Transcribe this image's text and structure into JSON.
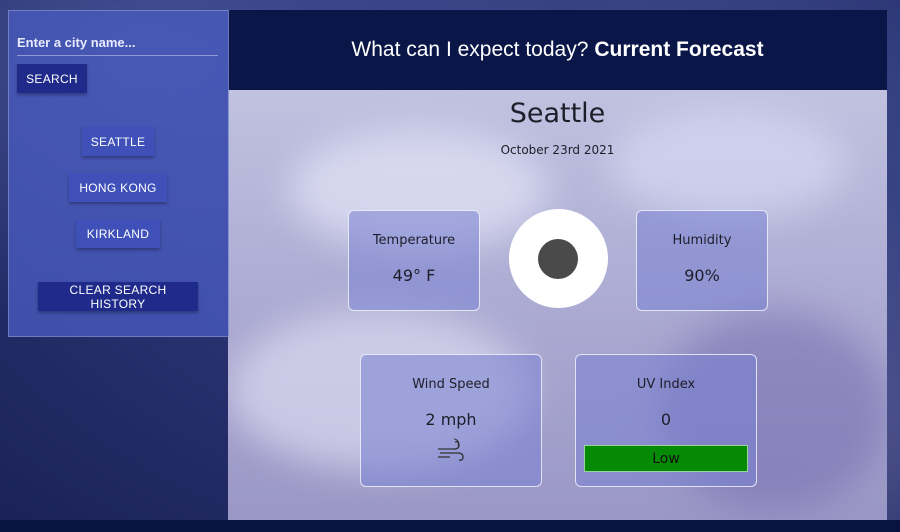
{
  "header": {
    "prefix": "What can I expect today?",
    "title": "Current Forecast"
  },
  "sidebar": {
    "search": {
      "placeholder": "Enter a city name...",
      "value": ""
    },
    "search_button": "SEARCH",
    "history": [
      "SEATTLE",
      "HONG KONG",
      "KIRKLAND"
    ],
    "clear_button": "CLEAR SEARCH HISTORY"
  },
  "forecast": {
    "city": "Seattle",
    "date": "October 23rd 2021",
    "temperature": {
      "label": "Temperature",
      "value": "49° F"
    },
    "humidity": {
      "label": "Humidity",
      "value": "90%"
    },
    "wind": {
      "label": "Wind Speed",
      "value": "2 mph"
    },
    "uv": {
      "label": "UV Index",
      "value": "0",
      "level": "Low",
      "level_color": "#058a05"
    },
    "weather_icon": "moon-circle-icon"
  }
}
